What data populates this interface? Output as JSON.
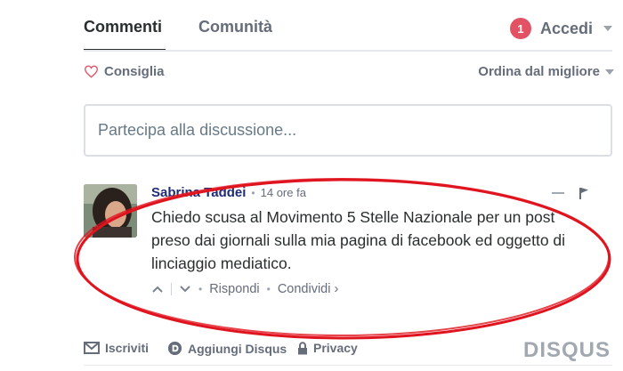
{
  "tabs": {
    "comments": "Commenti",
    "community": "Comunità"
  },
  "login": {
    "badge": "1",
    "label": "Accedi"
  },
  "toolbar": {
    "recommend": "Consiglia",
    "sort": "Ordina dal migliore"
  },
  "composer": {
    "placeholder": "Partecipa alla discussione..."
  },
  "comment": {
    "author": "Sabrina Taddei",
    "time": "14 ore fa",
    "message": "Chiedo scusa al Movimento 5 Stelle Nazionale per un post preso dai giornali sulla mia pagina di facebook ed oggetto di linciaggio mediatico.",
    "reply": "Rispondi",
    "share": "Condividi ›"
  },
  "footer": {
    "subscribe": "Iscriviti",
    "add_disqus": "Aggiungi Disqus",
    "privacy": "Privacy",
    "brand": "DISQUS"
  },
  "colors": {
    "annotation": "#e0141e",
    "badge": "#e25264",
    "author": "#1f2c75"
  }
}
